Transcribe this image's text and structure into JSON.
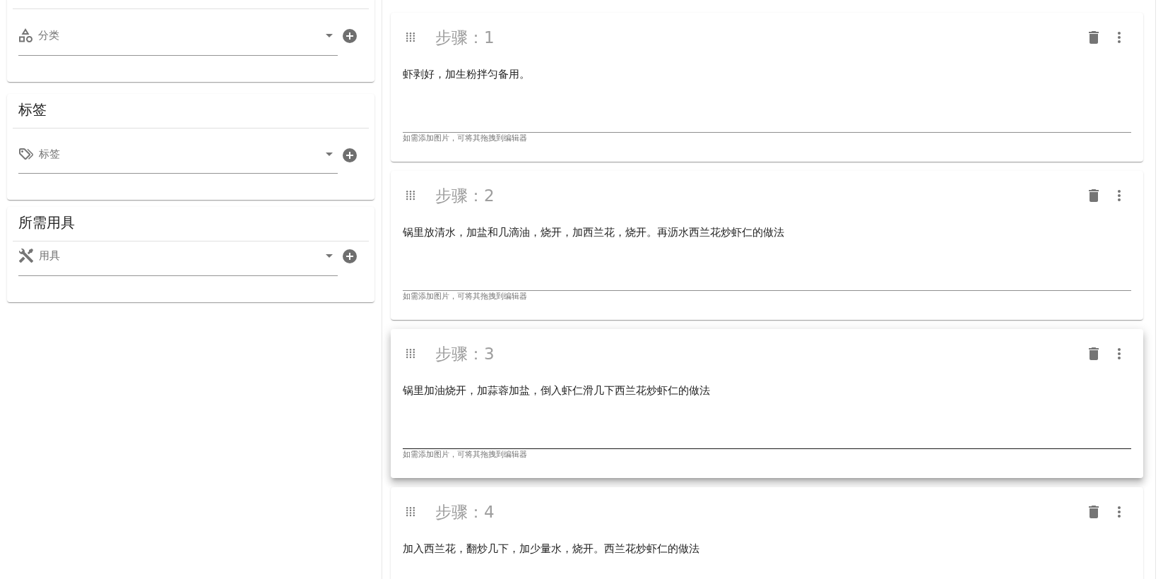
{
  "panels": [
    {
      "kind": "category",
      "placeholder": "分类"
    },
    {
      "kind": "tag",
      "title": "标签",
      "placeholder": "标签"
    },
    {
      "kind": "tool",
      "title": "所需用具",
      "placeholder": "用具"
    }
  ],
  "steps": [
    {
      "title": "步骤：1",
      "text": "虾剥好，加生粉拌匀备用。",
      "helper": "如需添加图片，可将其拖拽到编辑器",
      "focused": false
    },
    {
      "title": "步骤：2",
      "text": "锅里放清水，加盐和几滴油，烧开，加西兰花，烧开。再沥水西兰花炒虾仁的做法",
      "helper": "如需添加图片，可将其拖拽到编辑器",
      "focused": false
    },
    {
      "title": "步骤：3",
      "text": "锅里加油烧开，加蒜蓉加盐，倒入虾仁滑几下西兰花炒虾仁的做法",
      "helper": "如需添加图片，可将其拖拽到编辑器",
      "focused": true
    },
    {
      "title": "步骤：4",
      "text": "加入西兰花，翻炒几下，加少量水，烧开。西兰花炒虾仁的做法"
    }
  ]
}
